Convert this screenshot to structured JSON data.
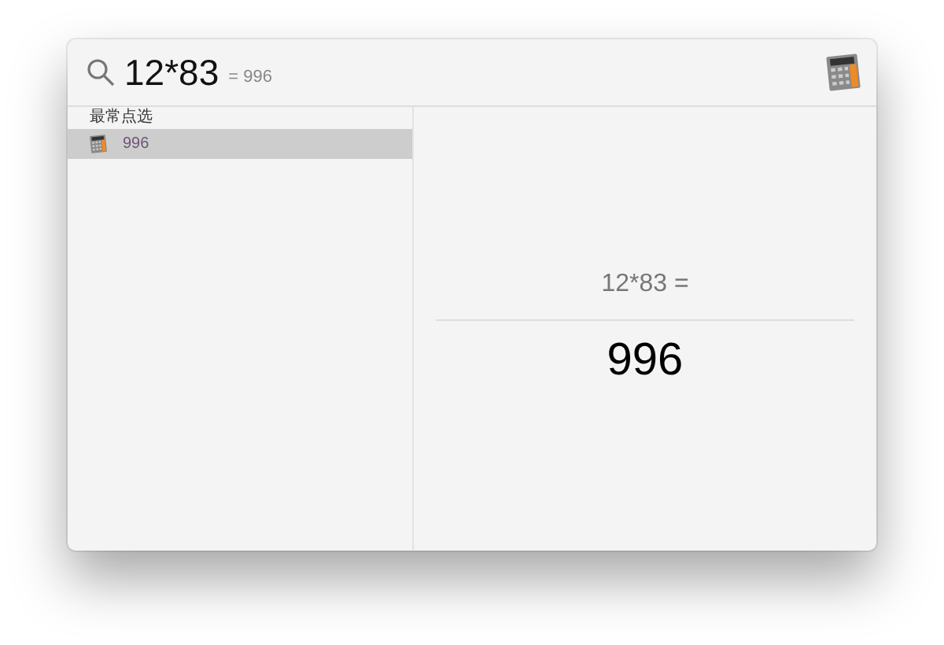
{
  "search": {
    "query": "12*83",
    "suggestion": "= 996"
  },
  "results": {
    "section_title": "最常点选",
    "items": [
      {
        "label": "996",
        "selected": true
      }
    ]
  },
  "preview": {
    "expression": "12*83 =",
    "result": "996"
  }
}
